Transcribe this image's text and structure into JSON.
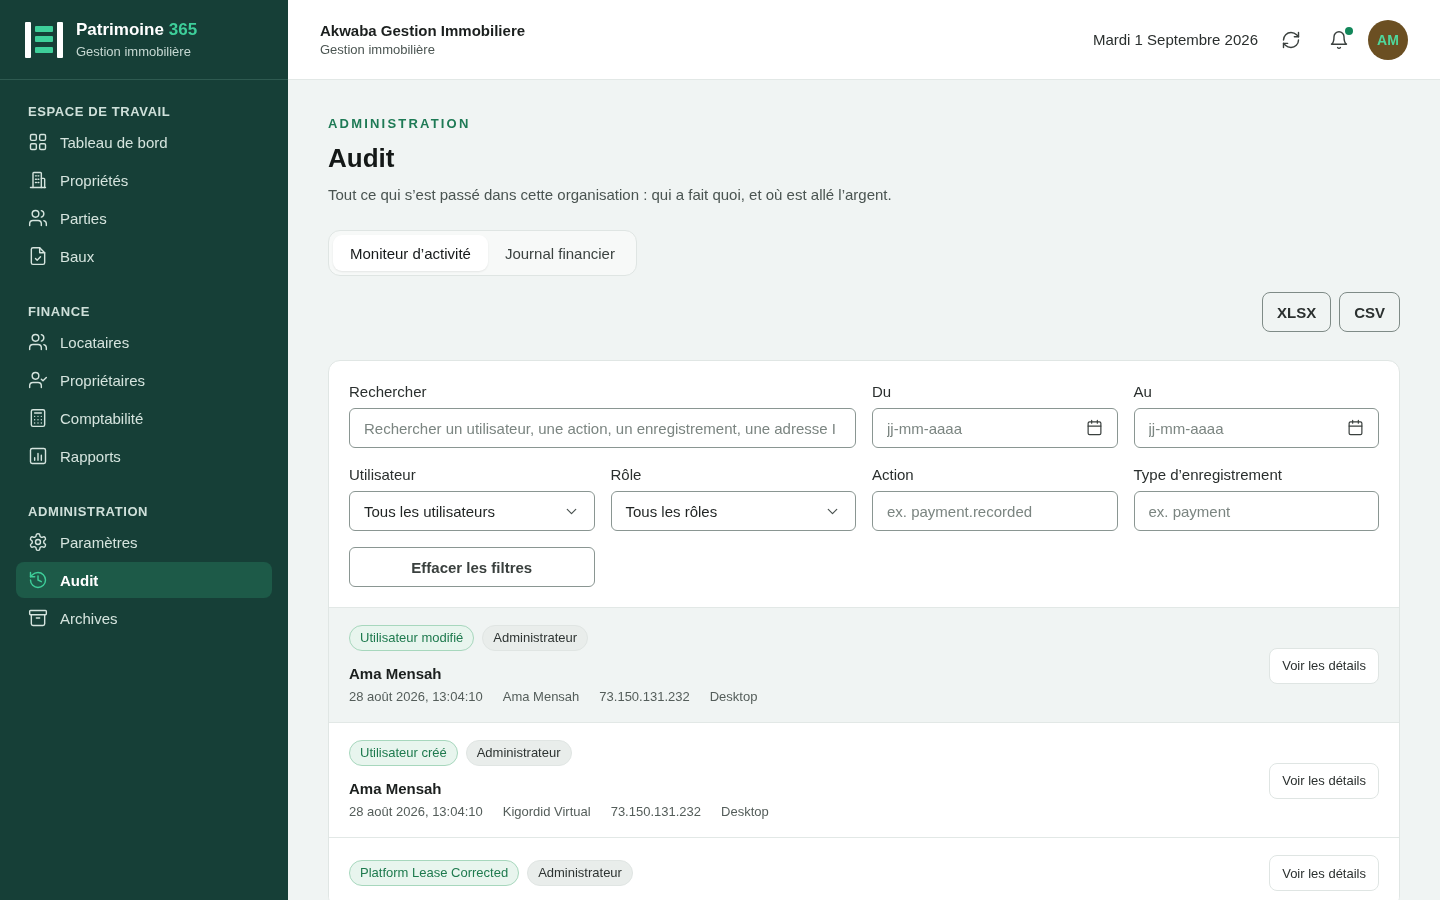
{
  "sidebar": {
    "brand": {
      "name": "Patrimoine",
      "accent": "365",
      "subtitle": "Gestion immobilière"
    },
    "sections": [
      {
        "title": "ESPACE DE TRAVAIL",
        "items": [
          {
            "label": "Tableau de bord",
            "selected": false
          },
          {
            "label": "Propriétés",
            "selected": false
          },
          {
            "label": "Parties",
            "selected": false
          },
          {
            "label": "Baux",
            "selected": false
          }
        ]
      },
      {
        "title": "FINANCE",
        "items": [
          {
            "label": "Locataires",
            "selected": false
          },
          {
            "label": "Propriétaires",
            "selected": false
          },
          {
            "label": "Comptabilité",
            "selected": false
          },
          {
            "label": "Rapports",
            "selected": false
          }
        ]
      },
      {
        "title": "ADMINISTRATION",
        "items": [
          {
            "label": "Paramètres",
            "selected": false
          },
          {
            "label": "Audit",
            "selected": true
          },
          {
            "label": "Archives",
            "selected": false
          }
        ]
      }
    ]
  },
  "header": {
    "organization": "Akwaba Gestion Immobiliere",
    "organization_subtitle": "Gestion immobilière",
    "date": "Mardi 1 Septembre 2026",
    "unread_notifications": true,
    "avatar_initials": "AM"
  },
  "page": {
    "eyebrow": "ADMINISTRATION",
    "title": "Audit",
    "description": "Tout ce qui s’est passé dans cette organisation : qui a fait quoi, et où est allé l’argent."
  },
  "tabs": [
    {
      "label": "Moniteur d’activité",
      "selected": true
    },
    {
      "label": "Journal financier",
      "selected": false
    }
  ],
  "exports": [
    "XLSX",
    "CSV"
  ],
  "filters": {
    "fields": [
      {
        "kind": "search",
        "label": "Rechercher",
        "placeholder": "Rechercher un utilisateur, une action, un enregistrement, une adresse I"
      },
      {
        "kind": "date",
        "label": "Du",
        "placeholder": "jj-mm-aaaa"
      },
      {
        "kind": "date",
        "label": "Au",
        "placeholder": "jj-mm-aaaa"
      },
      {
        "kind": "select",
        "label": "Utilisateur",
        "value": "Tous les utilisateurs"
      },
      {
        "kind": "select",
        "label": "Rôle",
        "value": "Tous les rôles"
      },
      {
        "kind": "text",
        "label": "Action",
        "placeholder": "ex. payment.recorded"
      },
      {
        "kind": "text",
        "label": "Type d’enregistrement",
        "placeholder": "ex. payment"
      }
    ],
    "clear_button": "Effacer les filtres"
  },
  "entries": [
    {
      "selected": true,
      "action": "Utilisateur modifié",
      "role": "Administrateur",
      "name": "Ama Mensah",
      "date": "28 août 2026, 13:04:10",
      "actor": "Ama Mensah",
      "ip": "73.150.131.232",
      "device": "Desktop",
      "details_button": "Voir les détails"
    },
    {
      "selected": false,
      "action": "Utilisateur créé",
      "role": "Administrateur",
      "name": "Ama Mensah",
      "date": "28 août 2026, 13:04:10",
      "actor": "Kigordid Virtual",
      "ip": "73.150.131.232",
      "device": "Desktop",
      "details_button": "Voir les détails"
    },
    {
      "selected": false,
      "action": "Platform Lease Corrected",
      "role": "Administrateur",
      "details_button": "Voir les détails"
    }
  ]
}
